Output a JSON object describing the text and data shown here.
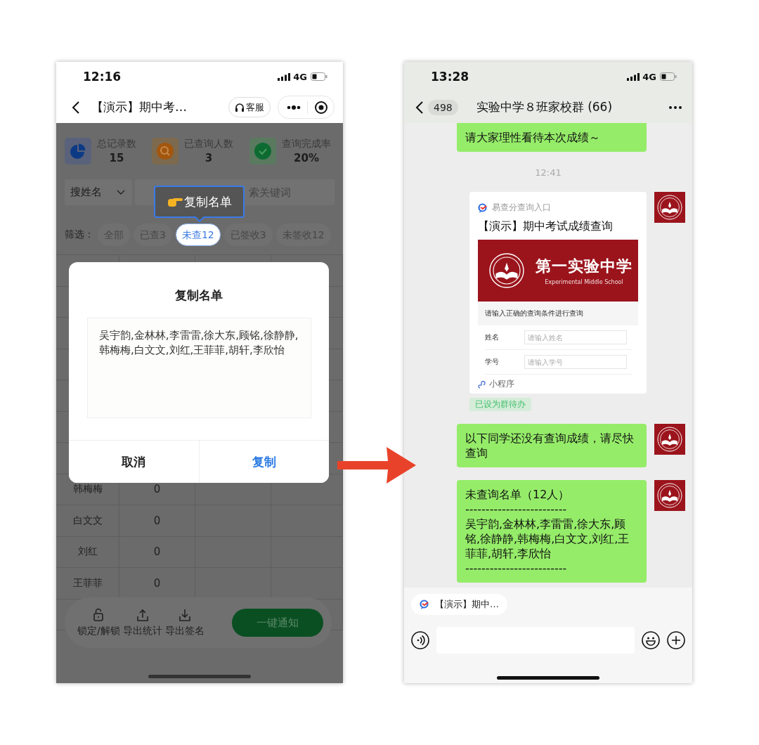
{
  "left_phone": {
    "status_bar": {
      "time": "12:16",
      "network": "4G"
    },
    "nav": {
      "title": "【演示】期中考…",
      "service_button": "客服"
    },
    "stats": [
      {
        "kind": "chart",
        "label": "总记录数",
        "value": "15"
      },
      {
        "kind": "search",
        "label": "已查询人数",
        "value": "3"
      },
      {
        "kind": "check",
        "label": "查询完成率",
        "value": "20%"
      }
    ],
    "search": {
      "field_type": "搜姓名",
      "placeholder": "索关键词"
    },
    "filter": {
      "label": "筛选：",
      "chips": [
        {
          "label": "全部",
          "selected": false
        },
        {
          "label": "已查3",
          "selected": false
        },
        {
          "label": "未查12",
          "selected": true
        },
        {
          "label": "已签收3",
          "selected": false
        },
        {
          "label": "未签收12",
          "selected": false
        }
      ]
    },
    "tooltip": {
      "text": "复制名单"
    },
    "table": {
      "rows": [
        {
          "name": "韩梅梅",
          "count": "0"
        },
        {
          "name": "白文文",
          "count": "0"
        },
        {
          "name": "刘红",
          "count": "0"
        },
        {
          "name": "王菲菲",
          "count": "0"
        }
      ]
    },
    "toolbar": {
      "actions": [
        {
          "kind": "lock",
          "label": "锁定/解锁"
        },
        {
          "kind": "upload",
          "label": "导出统计"
        },
        {
          "kind": "download",
          "label": "导出签名"
        }
      ],
      "primary_button": "一键通知"
    },
    "dialog": {
      "title": "复制名单",
      "content": "吴宇韵,金林林,李雷雷,徐大东,顾铭,徐静静,韩梅梅,白文文,刘红,王菲菲,胡轩,李欣怡",
      "cancel": "取消",
      "confirm": "复制"
    }
  },
  "right_phone": {
    "status_bar": {
      "time": "13:28",
      "network": "4G"
    },
    "nav": {
      "unread": "498",
      "title": "实验中学８班家校群 (66)"
    },
    "messages": [
      {
        "kind": "text",
        "text": "请大家理性看待本次成绩～",
        "show_avatar": false
      },
      {
        "kind": "time",
        "text": "12:41"
      },
      {
        "kind": "card",
        "source": "易查分查询入口",
        "title": "【演示】期中考试成绩查询",
        "banner_title": "第一实验中学",
        "banner_subtitle": "Experimental Middle School",
        "prompt": "请输入正确的查询条件进行查询",
        "fields": [
          {
            "label": "姓名",
            "placeholder": "请输入姓名"
          },
          {
            "label": "学号",
            "placeholder": "请输入学号"
          }
        ],
        "footer": "小程序",
        "tag": "已设为群待办"
      },
      {
        "kind": "text",
        "text": "以下同学还没有查询成绩，请尽快查询",
        "show_avatar": true
      },
      {
        "kind": "text",
        "text": "未查询名单（12人）\n-------------------------\n吴宇韵,金林林,李雷雷,徐大东,顾铭,徐静静,韩梅梅,白文文,刘红,王菲菲,胡轩,李欣怡\n-------------------------",
        "show_avatar": true
      }
    ],
    "draft_chip": {
      "text": "【演示】期中…"
    }
  }
}
